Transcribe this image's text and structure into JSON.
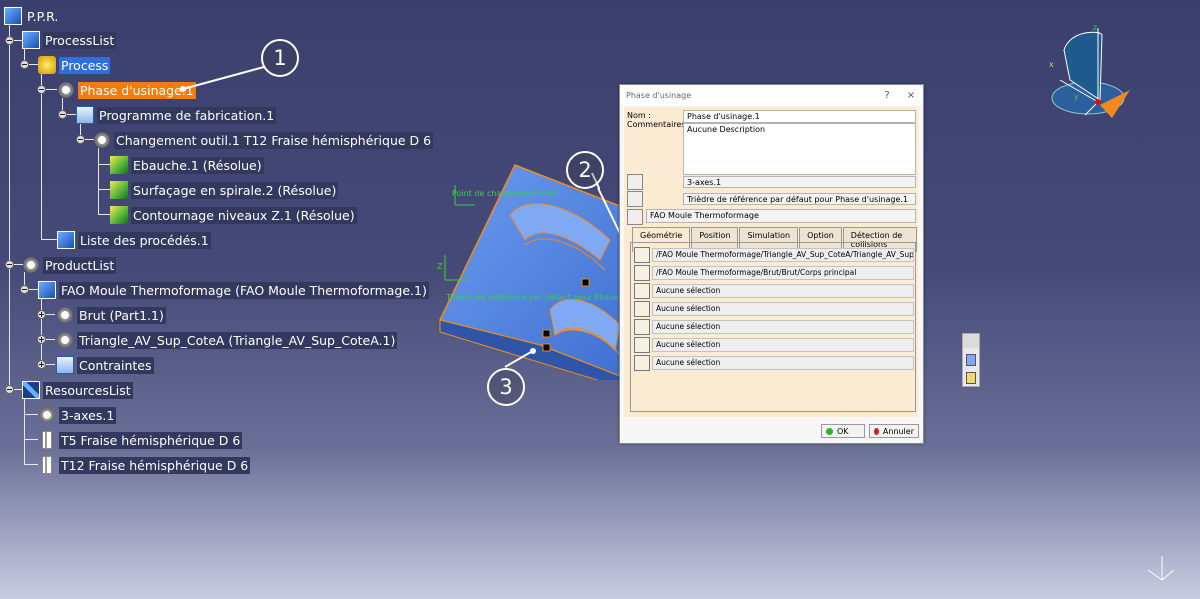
{
  "tree": {
    "root": "P.P.R.",
    "process_list": "ProcessList",
    "process": "Process",
    "phase": "Phase d'usinage.1",
    "programme": "Programme de fabrication.1",
    "changement": "Changement outil.1  T12 Fraise hémisphérique D 6",
    "ebauche": "Ebauche.1 (Résolue)",
    "surfacage": "Surfaçage en spirale.2 (Résolue)",
    "contournage": "Contournage niveaux Z.1 (Résolue)",
    "liste_procedes": "Liste des procédés.1",
    "product_list": "ProductList",
    "fao": "FAO Moule Thermoformage (FAO Moule Thermoformage.1)",
    "brut": "Brut (Part1.1)",
    "triangle": "Triangle_AV_Sup_CoteA (Triangle_AV_Sup_CoteA.1)",
    "contraintes": "Contraintes",
    "resources_list": "ResourcesList",
    "axes": "3-axes.1",
    "t5": "T5 Fraise hémisphérique D 6",
    "t12": "T12 Fraise hémisphérique D 6"
  },
  "callouts": [
    "1",
    "2",
    "3"
  ],
  "viewport": {
    "tool_change_point": "Point de changement outil",
    "ref_label": "Trièdre de référence par défaut pour Phase d'usinage.1",
    "axis_z": "Z",
    "axis_x": "X",
    "axis_y": "Y"
  },
  "compass": {
    "z": "z",
    "x": "x",
    "y": "y"
  },
  "dialog": {
    "title": "Phase d'usinage",
    "help": "?",
    "close": "×",
    "name_label": "Nom :",
    "name_value": "Phase d'usinage.1",
    "comments_label": "Commentaires :",
    "comments_value": "Aucune Description",
    "machine_value": "3-axes.1",
    "ref_value": "Trièdre de référence par défaut pour Phase d'usinage.1",
    "product_value": "FAO Moule Thermoformage",
    "tabs": [
      "Géométrie",
      "Position",
      "Simulation",
      "Option",
      "Détection de collisions"
    ],
    "geometry": [
      "/FAO Moule Thermoformage/Triangle_AV_Sup_CoteA/Triangle_AV_Sup_CoteA/",
      "/FAO Moule Thermoformage/Brut/Brut/Corps principal",
      "Aucune sélection",
      "Aucune sélection",
      "Aucune sélection",
      "Aucune sélection",
      "Aucune sélection"
    ],
    "ok": "OK",
    "cancel": "Annuler"
  },
  "colors": {
    "selection_orange": "#f47b0c",
    "selection_blue": "#2f6fdc",
    "dialog_bg": "#fcebd3",
    "part_orange": "#f08a1c"
  }
}
